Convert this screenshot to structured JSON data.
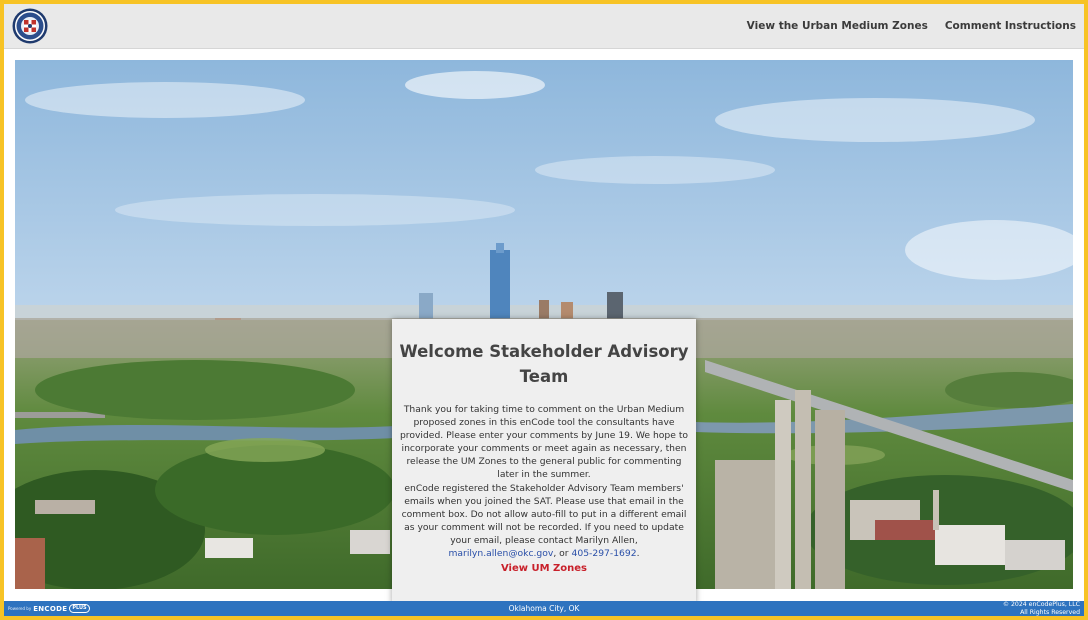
{
  "header": {
    "nav": [
      {
        "label": "View the Urban Medium Zones"
      },
      {
        "label": "Comment Instructions"
      }
    ]
  },
  "card": {
    "title": "Welcome Stakeholder Advisory Team",
    "paragraph1": "Thank you for taking time to comment on the Urban Medium proposed zones in this enCode tool the consultants have provided. Please enter your comments by June 19.   We hope to incorporate your comments or meet again as necessary,  then release the UM Zones to the general public for commenting later in the summer.",
    "paragraph2_text": "enCode registered the Stakeholder Advisory Team members' emails when you joined the SAT. Please use that email in the comment box. Do not allow auto-fill to put in a different email as your comment will not be recorded. If you need to update your email, please contact Marilyn Allen,",
    "email": "marilyn.allen@okc.gov",
    "separator": ", or ",
    "phone": "405-297-1692",
    "period": ".",
    "cta": "View UM Zones"
  },
  "footer": {
    "powered_label": "Powered by",
    "brand": "ENCODE",
    "brand_plus": "PLUS",
    "center": "Oklahoma City, OK",
    "copyright": "© 2024 enCodePlus, LLC",
    "rights": "All Rights Reserved"
  },
  "colors": {
    "page_border": "#f7c325",
    "header_bg": "#e9e9e9",
    "footer_bg": "#2e73bf",
    "cta": "#c8202a",
    "link": "#2a4fa8"
  },
  "icons": {
    "logo": "city-seal-icon"
  }
}
